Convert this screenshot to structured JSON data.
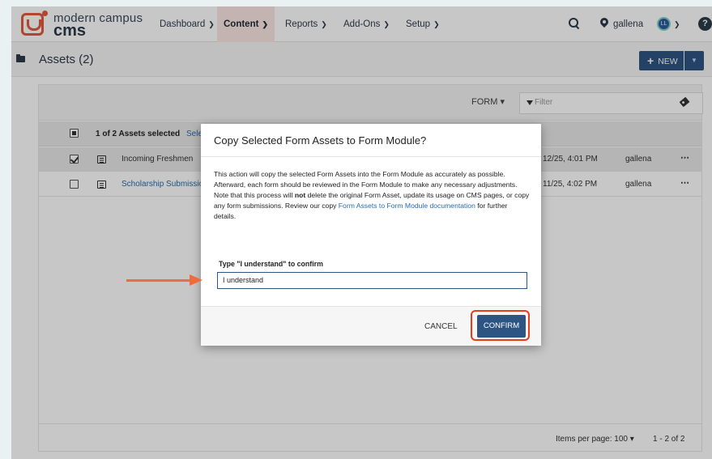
{
  "app": {
    "logo_top": "modern campus",
    "logo_bottom": "cms"
  },
  "nav": {
    "items": [
      {
        "label": "Dashboard"
      },
      {
        "label": "Content"
      },
      {
        "label": "Reports"
      },
      {
        "label": "Add-Ons"
      },
      {
        "label": "Setup"
      }
    ],
    "active": "Content",
    "user": "gallena",
    "avatar_initials": "LL",
    "help": "?"
  },
  "page": {
    "title": "Assets (2)",
    "new_label": "NEW"
  },
  "toolbar": {
    "type_filter": "FORM",
    "filter_placeholder": "Filter"
  },
  "selection": {
    "text": "1 of 2 Assets selected",
    "link": "Sele"
  },
  "assets": [
    {
      "name": "Incoming Freshmen",
      "date": "12/25, 4:01 PM",
      "user": "gallena",
      "checked": true
    },
    {
      "name": "Scholarship Submission F",
      "date": "11/25, 4:02 PM",
      "user": "gallena",
      "checked": false
    }
  ],
  "pagination": {
    "per_page_label": "Items per page:",
    "per_page_value": "100",
    "range": "1 - 2 of 2"
  },
  "modal": {
    "title": "Copy Selected Form Assets to Form Module?",
    "body_part1": "This action will copy the selected Form Assets into the Form Module as accurately as possible. Afterward, each form should be reviewed in the Form Module to make any necessary adjustments. Note that this process will ",
    "body_bold": "not",
    "body_part2": " delete the original Form Asset, update its usage on CMS pages, or copy any form submissions. Review our copy ",
    "body_link": "Form Assets to Form Module documentation",
    "body_part3": " for further details.",
    "confirm_label": "Type \"I understand\" to confirm",
    "confirm_value": "I understand",
    "cancel_label": "CANCEL",
    "confirm_button": "CONFIRM"
  },
  "colors": {
    "brand": "#e15a3d",
    "primary_button": "#2d5583",
    "highlight": "#e63d1b",
    "annotation_arrow": "#ee6b3b",
    "link": "#2a6ca8"
  }
}
